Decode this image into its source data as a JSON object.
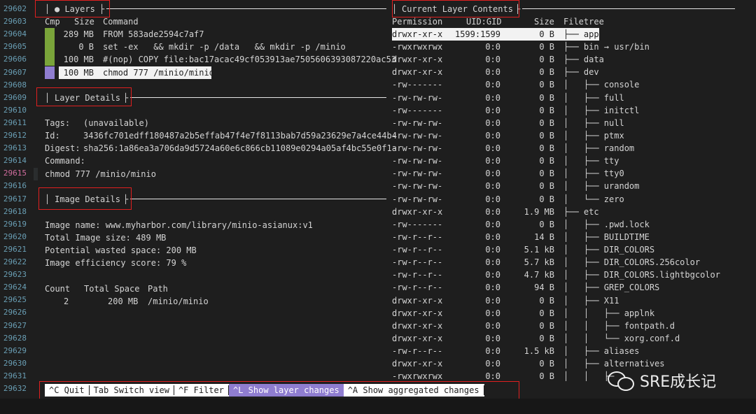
{
  "gutter": {
    "line_numbers": [
      "29602",
      "29603",
      "29604",
      "29605",
      "29606",
      "29607",
      "29608",
      "29609",
      "29610",
      "29611",
      "29612",
      "29613",
      "29614",
      "29615",
      "29616",
      "29617",
      "29618",
      "29619",
      "29620",
      "29621",
      "29622",
      "29623",
      "29624",
      "29625",
      "29626",
      "29627",
      "29628",
      "29629",
      "29630",
      "29631",
      "29632"
    ],
    "current_line": "29615"
  },
  "layers": {
    "title": "● Layers",
    "col_cmp": "Cmp",
    "col_size": "Size",
    "col_command": "Command",
    "rows": [
      {
        "size": "289 MB",
        "command": "FROM 583ade2594c7af7",
        "bar": "#7aa43a"
      },
      {
        "size": "0 B",
        "command": "set -ex   && mkdir -p /data   && mkdir -p /minio",
        "bar": "#7aa43a"
      },
      {
        "size": "100 MB",
        "command": "#(nop) COPY file:bac17acac49cf053913ae7505606393087220ac53",
        "bar": "#7aa43a"
      },
      {
        "size": "100 MB",
        "command": "chmod 777 /minio/minio",
        "bar": "#8f7dd0"
      }
    ]
  },
  "layer_details": {
    "title": "Layer Details",
    "tags_label": "Tags:",
    "tags_value": "(unavailable)",
    "id_label": "Id:",
    "id_value": "3436fc701edff180487a2b5effab47f4e7f8113bab7d59a23629e7a4ce44b4",
    "digest_label": "Digest:",
    "digest_value": "sha256:1a86ea3a706da9d5724a60e6c866cb11089e0294a05af4bc55e0f1a",
    "command_label": "Command:",
    "command_value": "chmod 777 /minio/minio"
  },
  "image_details": {
    "title": "Image Details",
    "name_line": "Image name: www.myharbor.com/library/minio-asianux:v1",
    "size_line": "Total Image size: 489 MB",
    "wasted_line": "Potential wasted space: 200 MB",
    "efficiency_line": "Image efficiency score: 79 %",
    "col_count": "Count",
    "col_total": "Total Space",
    "col_path": "Path",
    "rows": [
      {
        "count": "2",
        "total": "200 MB",
        "path": "/minio/minio"
      }
    ]
  },
  "contents": {
    "title": "Current Layer Contents",
    "col_permission": "Permission",
    "col_uidgid": "UID:GID",
    "col_size": "Size",
    "col_filetree": "Filetree",
    "rows": [
      {
        "perm": "drwxr-xr-x",
        "uid": "1599:1599",
        "size": "0 B",
        "tree": "├── app"
      },
      {
        "perm": "-rwxrwxrwx",
        "uid": "0:0",
        "size": "0 B",
        "tree": "├── bin → usr/bin"
      },
      {
        "perm": "drwxr-xr-x",
        "uid": "0:0",
        "size": "0 B",
        "tree": "├── data"
      },
      {
        "perm": "drwxr-xr-x",
        "uid": "0:0",
        "size": "0 B",
        "tree": "├── dev"
      },
      {
        "perm": "-rw-------",
        "uid": "0:0",
        "size": "0 B",
        "tree": "│   ├── console"
      },
      {
        "perm": "-rw-rw-rw-",
        "uid": "0:0",
        "size": "0 B",
        "tree": "│   ├── full"
      },
      {
        "perm": "-rw-------",
        "uid": "0:0",
        "size": "0 B",
        "tree": "│   ├── initctl"
      },
      {
        "perm": "-rw-rw-rw-",
        "uid": "0:0",
        "size": "0 B",
        "tree": "│   ├── null"
      },
      {
        "perm": "-rw-rw-rw-",
        "uid": "0:0",
        "size": "0 B",
        "tree": "│   ├── ptmx"
      },
      {
        "perm": "-rw-rw-rw-",
        "uid": "0:0",
        "size": "0 B",
        "tree": "│   ├── random"
      },
      {
        "perm": "-rw-rw-rw-",
        "uid": "0:0",
        "size": "0 B",
        "tree": "│   ├── tty"
      },
      {
        "perm": "-rw-rw-rw-",
        "uid": "0:0",
        "size": "0 B",
        "tree": "│   ├── tty0"
      },
      {
        "perm": "-rw-rw-rw-",
        "uid": "0:0",
        "size": "0 B",
        "tree": "│   ├── urandom"
      },
      {
        "perm": "-rw-rw-rw-",
        "uid": "0:0",
        "size": "0 B",
        "tree": "│   └── zero"
      },
      {
        "perm": "drwxr-xr-x",
        "uid": "0:0",
        "size": "1.9 MB",
        "tree": "├── etc"
      },
      {
        "perm": "-rw-------",
        "uid": "0:0",
        "size": "0 B",
        "tree": "│   ├── .pwd.lock"
      },
      {
        "perm": "-rw-r--r--",
        "uid": "0:0",
        "size": "14 B",
        "tree": "│   ├── BUILDTIME"
      },
      {
        "perm": "-rw-r--r--",
        "uid": "0:0",
        "size": "5.1 kB",
        "tree": "│   ├── DIR_COLORS"
      },
      {
        "perm": "-rw-r--r--",
        "uid": "0:0",
        "size": "5.7 kB",
        "tree": "│   ├── DIR_COLORS.256color"
      },
      {
        "perm": "-rw-r--r--",
        "uid": "0:0",
        "size": "4.7 kB",
        "tree": "│   ├── DIR_COLORS.lightbgcolor"
      },
      {
        "perm": "-rw-r--r--",
        "uid": "0:0",
        "size": "94 B",
        "tree": "│   ├── GREP_COLORS"
      },
      {
        "perm": "drwxr-xr-x",
        "uid": "0:0",
        "size": "0 B",
        "tree": "│   ├── X11"
      },
      {
        "perm": "drwxr-xr-x",
        "uid": "0:0",
        "size": "0 B",
        "tree": "│   │   ├── applnk"
      },
      {
        "perm": "drwxr-xr-x",
        "uid": "0:0",
        "size": "0 B",
        "tree": "│   │   ├── fontpath.d"
      },
      {
        "perm": "drwxr-xr-x",
        "uid": "0:0",
        "size": "0 B",
        "tree": "│   │   └── xorg.conf.d"
      },
      {
        "perm": "-rw-r--r--",
        "uid": "0:0",
        "size": "1.5 kB",
        "tree": "│   ├── aliases"
      },
      {
        "perm": "drwxr-xr-x",
        "uid": "0:0",
        "size": "0 B",
        "tree": "│   ├── alternatives"
      },
      {
        "perm": "-rwxrwxrwx",
        "uid": "0:0",
        "size": "0 B",
        "tree": "│   │   ├─"
      }
    ]
  },
  "footer": {
    "quit": "^C Quit",
    "switch": "Tab Switch view",
    "filter": "^F Filter",
    "layer_changes": "^L Show layer changes",
    "aggregated": "^A Show aggregated changes"
  },
  "watermark": {
    "text": "SRE成长记"
  },
  "colors": {
    "bar_green": "#7aa43a",
    "bar_purple": "#8f7dd0",
    "highlight": "#f2f2f2",
    "annotation_red": "#e02020"
  }
}
